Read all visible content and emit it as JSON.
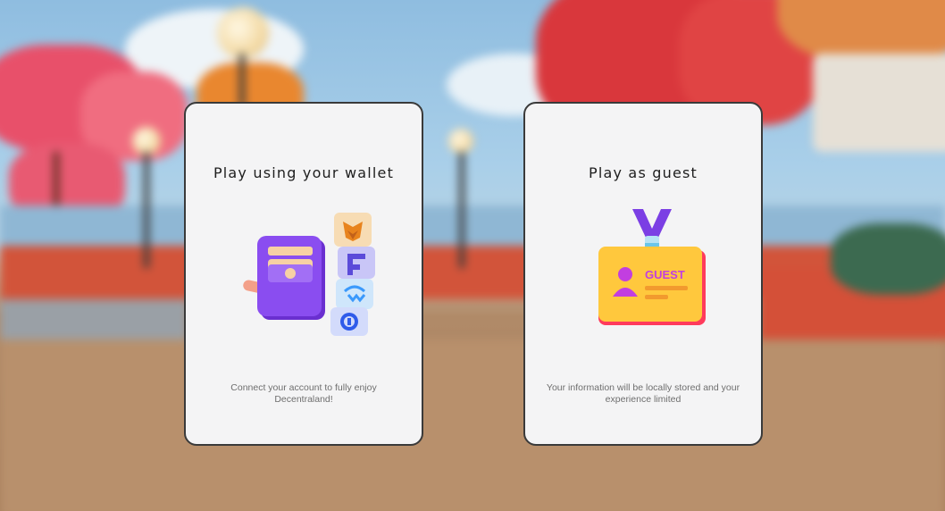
{
  "wallet_card": {
    "title": "Play using your wallet",
    "description": "Connect your account to fully enjoy Decentraland!",
    "icons": [
      "wallet-icon",
      "metamask-fox-icon",
      "fortmatic-icon",
      "walletconnect-icon",
      "coinbase-icon"
    ]
  },
  "guest_card": {
    "title": "Play as guest",
    "description": "Your information will be locally stored and your experience limited",
    "badge_text": "GUEST",
    "icons": [
      "guest-badge-icon"
    ]
  },
  "colors": {
    "card_bg": "#f4f4f5",
    "card_border": "#3a3a3a",
    "wallet_purple": "#8a4df0",
    "badge_yellow": "#ffc83d",
    "badge_red": "#ff3b5c"
  }
}
